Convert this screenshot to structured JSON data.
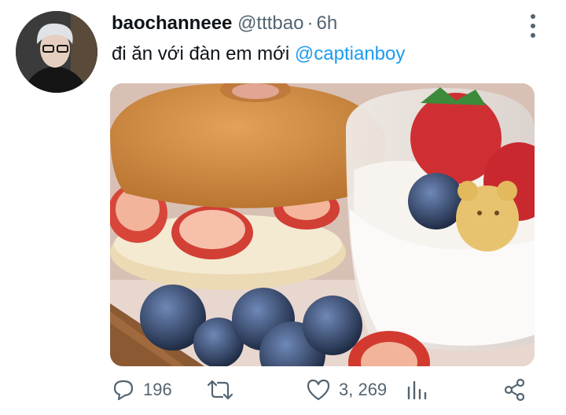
{
  "tweet": {
    "display_name": "baochanneee",
    "handle": "@tttbao",
    "separator": "·",
    "time": "6h",
    "text": "đi ăn với đàn em mới ",
    "mention": "@captianboy"
  },
  "media": {
    "description": "bagel with strawberries and cream, blueberries, and a glass cup of whipped cream topped with strawberries, blueberries and a bear biscuit"
  },
  "actions": {
    "reply_count": "196",
    "like_count": "3, 269"
  },
  "icons": [
    "more-vertical-icon",
    "reply-icon",
    "retweet-icon",
    "like-icon",
    "analytics-icon",
    "share-icon"
  ],
  "colors": {
    "link": "#1d9bf0",
    "secondary": "#536471",
    "text": "#0f1419"
  }
}
